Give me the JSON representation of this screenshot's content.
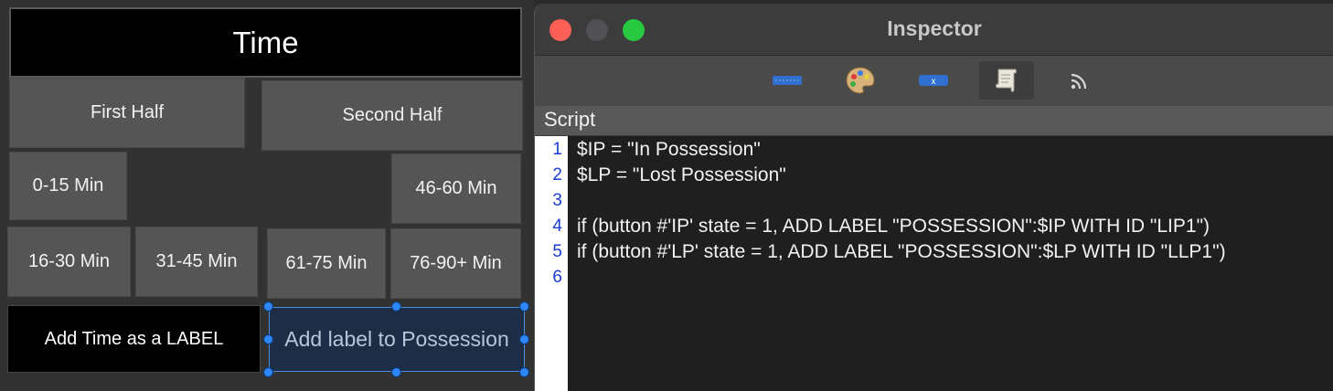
{
  "canvas": {
    "title": "Time",
    "buttons": {
      "first_half": "First Half",
      "second_half": "Second Half",
      "min_0_15": "0-15 Min",
      "min_46_60": "46-60 Min",
      "min_16_30": "16-30 Min",
      "min_31_45": "31-45 Min",
      "min_61_75": "61-75 Min",
      "min_76_90": "76-90+ Min",
      "add_time_label": "Add Time as a LABEL",
      "add_possession_label": "Add label to Possession"
    }
  },
  "inspector": {
    "title": "Inspector",
    "section": "Script",
    "toolbar_icons": [
      "ruler-icon",
      "palette-icon",
      "variable-tag-icon",
      "script-scroll-icon",
      "broadcast-icon"
    ],
    "active_tool": "script-scroll-icon",
    "code_lines": [
      {
        "n": "1",
        "text": "$IP = \"In Possession\""
      },
      {
        "n": "2",
        "text": "$LP = \"Lost Possession\""
      },
      {
        "n": "3",
        "text": ""
      },
      {
        "n": "4",
        "text": "if (button #'IP' state = 1, ADD LABEL \"POSSESSION\":$IP WITH ID \"LIP1\")"
      },
      {
        "n": "5",
        "text": "if (button #'LP' state = 1, ADD LABEL \"POSSESSION\":$LP WITH ID \"LLP1\")"
      },
      {
        "n": "6",
        "text": ""
      }
    ]
  },
  "colors": {
    "selection": "#2f86f6",
    "line_numbers": "#1a3ed6",
    "close": "#fe5f57",
    "maximize": "#28c840"
  }
}
